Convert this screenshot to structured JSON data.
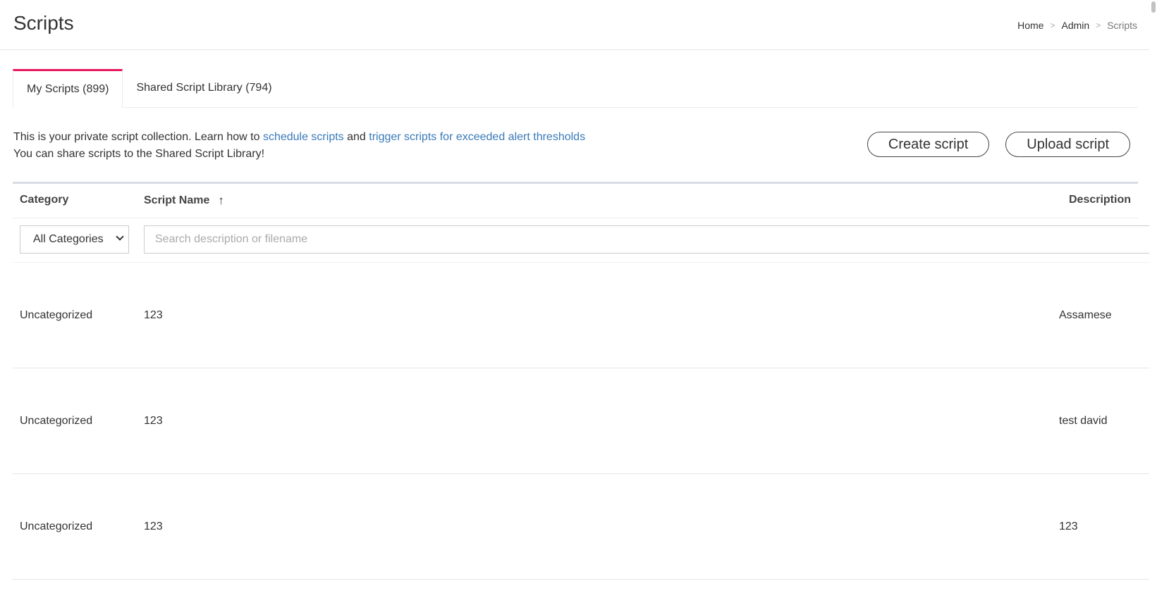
{
  "header": {
    "title": "Scripts",
    "breadcrumb": [
      "Home",
      "Admin",
      "Scripts"
    ],
    "separator": ">"
  },
  "tabs": [
    {
      "label": "My Scripts (899)",
      "active": true
    },
    {
      "label": "Shared Script Library (794)",
      "active": false
    }
  ],
  "intro": {
    "line1_prefix": "This is your private script collection. Learn how to ",
    "link1": "schedule scripts",
    "line1_mid": " and ",
    "link2": "trigger scripts for exceeded alert thresholds",
    "line2": "You can share scripts to the Shared Script Library!"
  },
  "actions": {
    "create_label": "Create script",
    "upload_label": "Upload script"
  },
  "table": {
    "columns": {
      "category": "Category",
      "name": "Script Name",
      "description": "Description"
    },
    "sort_icon": "arrow-up-icon",
    "filter": {
      "category_selected": "All Categories",
      "search_placeholder": "Search description or filename"
    },
    "rows": [
      {
        "category": "Uncategorized",
        "name": "123",
        "description": "Assamese"
      },
      {
        "category": "Uncategorized",
        "name": "123",
        "description": "test david"
      },
      {
        "category": "Uncategorized",
        "name": "123",
        "description": "123"
      }
    ]
  },
  "colors": {
    "accent_tab": "#e8175d",
    "link": "#3a7ab8"
  }
}
